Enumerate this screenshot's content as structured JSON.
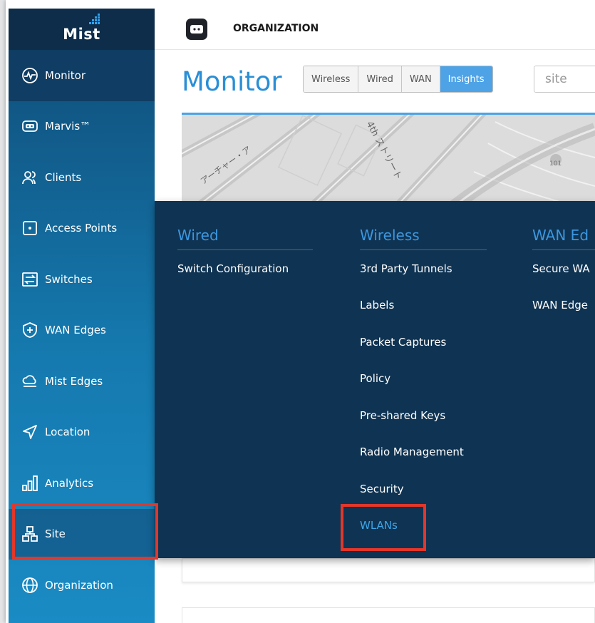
{
  "app": {
    "brand": "Mist",
    "org_label": "ORGANIZATION"
  },
  "sidebar": {
    "items": [
      {
        "label": "Monitor",
        "icon": "monitor-icon"
      },
      {
        "label": "Marvis™",
        "icon": "marvis-icon"
      },
      {
        "label": "Clients",
        "icon": "clients-icon"
      },
      {
        "label": "Access Points",
        "icon": "access-point-icon"
      },
      {
        "label": "Switches",
        "icon": "switch-icon"
      },
      {
        "label": "WAN Edges",
        "icon": "wan-edge-icon"
      },
      {
        "label": "Mist Edges",
        "icon": "mist-edge-icon"
      },
      {
        "label": "Location",
        "icon": "location-icon"
      },
      {
        "label": "Analytics",
        "icon": "analytics-icon"
      },
      {
        "label": "Site",
        "icon": "site-icon"
      },
      {
        "label": "Organization",
        "icon": "organization-icon"
      }
    ]
  },
  "page": {
    "title": "Monitor",
    "tabs": [
      "Wireless",
      "Wired",
      "WAN",
      "Insights"
    ],
    "active_tab": "Insights",
    "site_placeholder": "site"
  },
  "map": {
    "street_labels": [
      "アーチャー・ア",
      "4th ストリート",
      "101"
    ]
  },
  "menu": {
    "wired": {
      "heading": "Wired",
      "items": [
        "Switch Configuration"
      ]
    },
    "wireless": {
      "heading": "Wireless",
      "items": [
        "3rd Party Tunnels",
        "Labels",
        "Packet Captures",
        "Policy",
        "Pre-shared Keys",
        "Radio Management",
        "Security",
        "WLANs"
      ]
    },
    "wan_edges": {
      "heading": "WAN Ed",
      "items": [
        "Secure WA",
        "WAN Edge"
      ]
    }
  },
  "colors": {
    "accent": "#2a8fd6",
    "highlight_box": "#e2372a",
    "menu_bg": "#0f3352",
    "sidebar_top": "#0f4a75"
  }
}
